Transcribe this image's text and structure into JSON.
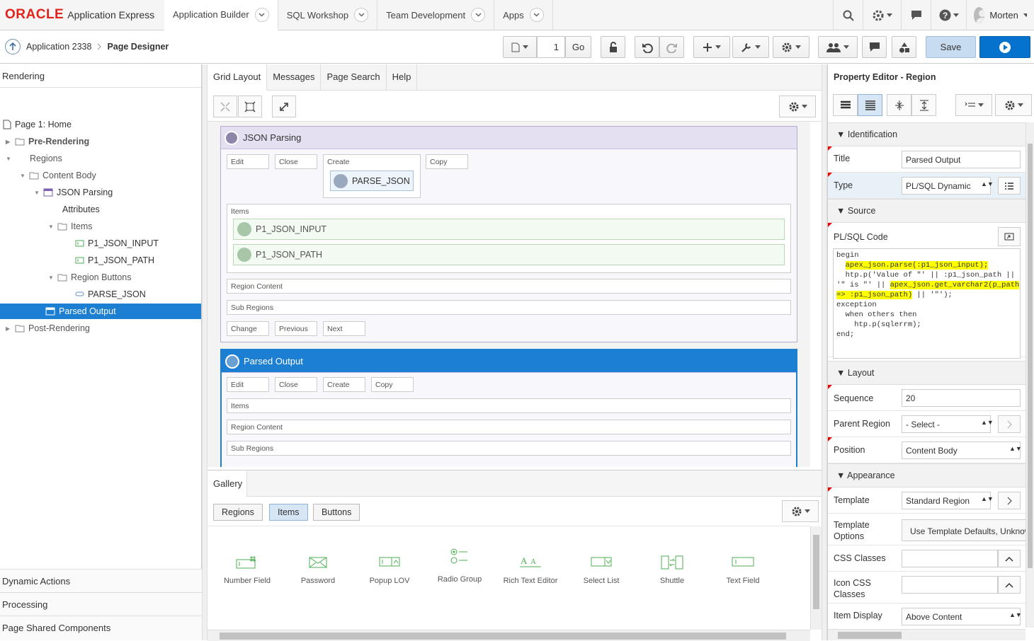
{
  "brand": {
    "oracle": "ORACLE",
    "product": "Application Express"
  },
  "top_tabs": [
    {
      "label": "Application Builder"
    },
    {
      "label": "SQL Workshop"
    },
    {
      "label": "Team Development"
    },
    {
      "label": "Apps"
    }
  ],
  "user": {
    "name": "Morten"
  },
  "breadcrumb": {
    "app": "Application 2338",
    "page": "Page Designer"
  },
  "toolbar": {
    "page_number": "1",
    "go_label": "Go",
    "save_label": "Save"
  },
  "left_panel": {
    "header": "Rendering",
    "tree": [
      "Page 1: Home",
      "Pre-Rendering",
      "Regions",
      "Content Body",
      "JSON Parsing",
      "Attributes",
      "Items",
      "P1_JSON_INPUT",
      "P1_JSON_PATH",
      "Region Buttons",
      "PARSE_JSON",
      "Parsed Output",
      "Post-Rendering"
    ],
    "footer": [
      "Dynamic Actions",
      "Processing",
      "Page Shared Components"
    ]
  },
  "center": {
    "tabs": [
      "Grid Layout",
      "Messages",
      "Page Search",
      "Help"
    ],
    "region1": {
      "title": "JSON Parsing",
      "slots": [
        "Edit",
        "Close",
        "Create",
        "Copy"
      ],
      "button": "PARSE_JSON",
      "items_label": "Items",
      "items": [
        "P1_JSON_INPUT",
        "P1_JSON_PATH"
      ],
      "region_content": "Region Content",
      "sub_regions": "Sub Regions",
      "nav": [
        "Change",
        "Previous",
        "Next"
      ]
    },
    "region2": {
      "title": "Parsed Output",
      "slots": [
        "Edit",
        "Close",
        "Create",
        "Copy"
      ],
      "items_label": "Items",
      "region_content": "Region Content",
      "sub_regions": "Sub Regions"
    },
    "gallery": {
      "tab": "Gallery",
      "buttons": [
        "Regions",
        "Items",
        "Buttons"
      ],
      "items": [
        "Number Field",
        "Password",
        "Popup LOV",
        "Radio Group",
        "Rich Text Editor",
        "Select List",
        "Shuttle",
        "Text Field"
      ]
    }
  },
  "property_editor": {
    "title": "Property Editor - Region",
    "sections": {
      "identification": "Identification",
      "source": "Source",
      "layout": "Layout",
      "appearance": "Appearance"
    },
    "fields": {
      "title_label": "Title",
      "title_value": "Parsed Output",
      "type_label": "Type",
      "type_value": "PL/SQL Dynamic",
      "plsql_label": "PL/SQL Code",
      "sequence_label": "Sequence",
      "sequence_value": "20",
      "parent_label": "Parent Region",
      "parent_value": "- Select -",
      "position_label": "Position",
      "position_value": "Content Body",
      "template_label": "Template",
      "template_value": "Standard Region",
      "template_options_label": "Template Options",
      "template_options_value": "Use Template Defaults, Unknown",
      "css_label": "CSS Classes",
      "icon_css_label": "Icon CSS Classes",
      "item_display_label": "Item Display",
      "item_display_value": "Above Content"
    },
    "code": {
      "l1": "begin",
      "l2a": "  ",
      "l2b": "apex_json.parse(:p1_json_input);",
      "l3": "  htp.p('Value of \"' || :p1_json_path ||",
      "l4a": "'\" is \"' || ",
      "l4b": "apex_json.get_varchar2(p_path",
      "l5a": "=> :p1_json_path)",
      "l5b": " || '\"');",
      "l6": "exception",
      "l7": "  when others then",
      "l8": "    htp.p(sqlerrm);",
      "l9": "end;"
    }
  },
  "colors": {
    "accent": "#1c7fd1",
    "oracle_red": "#e2231a",
    "highlight": "#ffff00"
  }
}
